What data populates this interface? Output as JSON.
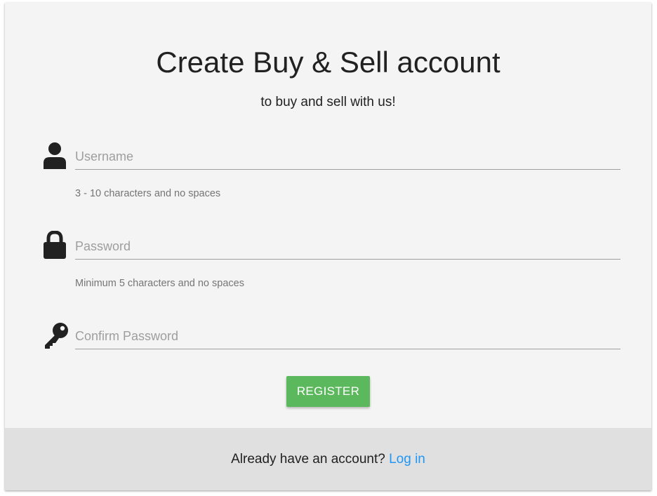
{
  "form": {
    "title": "Create Buy & Sell account",
    "subtitle": "to buy and sell with us!",
    "fields": [
      {
        "icon": "user-icon",
        "placeholder": "Username",
        "value": "",
        "hint": "3 - 10 characters and no spaces"
      },
      {
        "icon": "lock-icon",
        "placeholder": "Password",
        "value": "",
        "hint": "Minimum 5 characters and no spaces"
      },
      {
        "icon": "key-icon",
        "placeholder": "Confirm Password",
        "value": ""
      }
    ],
    "register_label": "REGISTER"
  },
  "footer": {
    "prompt": "Already have an account?",
    "login_label": "Log in"
  },
  "colors": {
    "card_background": "#f4f4f4",
    "footer_background": "#e0e0e0",
    "register_button": "#5cb85c",
    "link": "#2196f3",
    "icon": "#212121"
  }
}
